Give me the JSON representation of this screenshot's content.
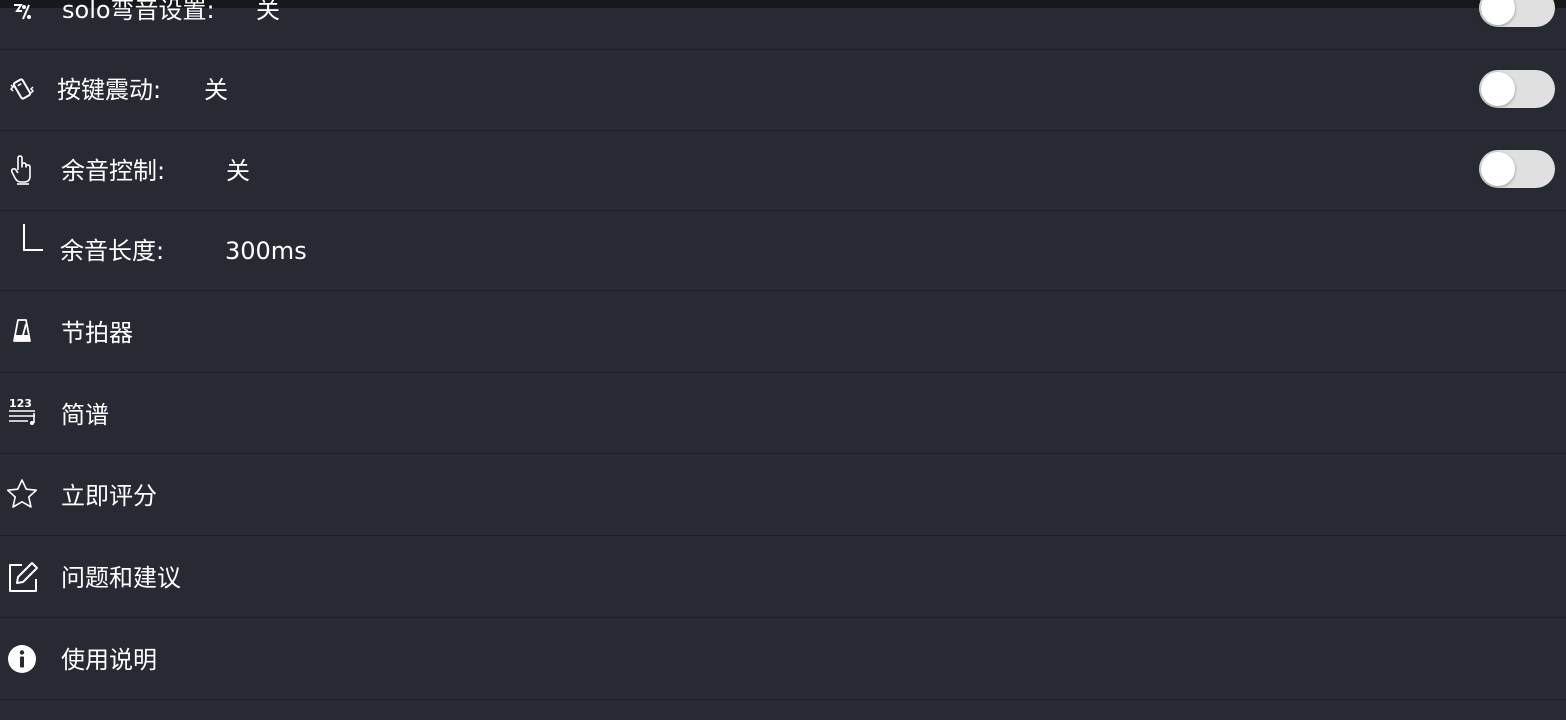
{
  "settings": {
    "solo": {
      "label": "solo弯音设置:",
      "value": "关",
      "icon": "bend-icon",
      "toggle_on": false
    },
    "vibration": {
      "label": "按键震动:",
      "value": "关",
      "icon": "vibration-icon",
      "toggle_on": false
    },
    "sustain": {
      "label": "余音控制:",
      "value": "关",
      "icon": "hand-pointer-icon",
      "toggle_on": false
    },
    "sustain_length": {
      "label": "余音长度:",
      "value": "300ms",
      "icon": "corner-indent-icon"
    },
    "metronome": {
      "label": "节拍器",
      "icon": "metronome-icon"
    },
    "notation": {
      "label": "简谱",
      "icon": "numbered-notation-icon",
      "icon_text": "123"
    },
    "rate": {
      "label": "立即评分",
      "icon": "star-icon"
    },
    "feedback": {
      "label": "问题和建议",
      "icon": "edit-icon"
    },
    "help": {
      "label": "使用说明",
      "icon": "info-icon"
    }
  },
  "colors": {
    "background": "#272a33",
    "divider": "#1d1f26",
    "toggle_track": "#e0e0e0",
    "text": "#ffffff"
  }
}
